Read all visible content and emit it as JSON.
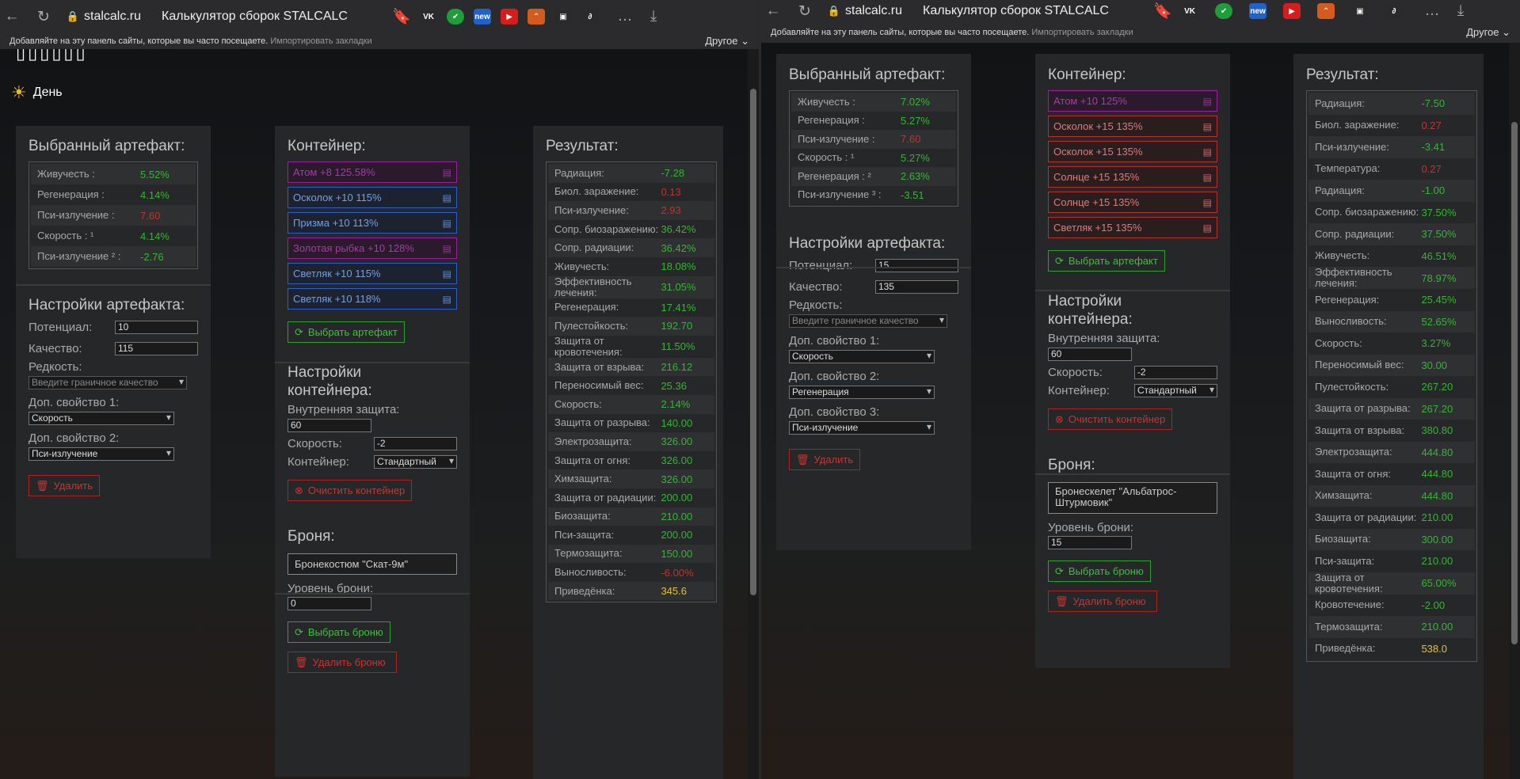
{
  "browser": {
    "back": "←",
    "reload": "↻",
    "lock": "🔒",
    "host": "stalcalc.ru",
    "title": "Калькулятор сборок STALCALC",
    "bookmark": "🔖",
    "download": "⤓",
    "more": "…",
    "exts": [
      {
        "label": "VK",
        "color": "#2a2a2a"
      },
      {
        "label": "✔",
        "color": "#1f9d3b"
      },
      {
        "label": "new",
        "color": "#2062c8"
      },
      {
        "label": "▶",
        "color": "#d41e1e"
      },
      {
        "label": "⌃",
        "color": "#d45a1e"
      },
      {
        "label": "▣",
        "color": "#2a2a2a"
      },
      {
        "label": "∂",
        "color": "#2a2a2a"
      }
    ],
    "bm_text": "Добавляйте на эту панель сайты, которые вы часто посещаете.",
    "bm_import": "Импортировать закладки",
    "bm_other": "Другое ⌄"
  },
  "common": {
    "selected_title": "Выбранный артефакт:",
    "container_title": "Контейнер:",
    "result_title": "Результат:",
    "settings_title": "Настройки артефакта:",
    "potential": "Потенциал:",
    "quality": "Качество:",
    "rarity": "Редкость:",
    "rarity_placeholder": "Введите граничное качество",
    "extra1": "Доп. свойство 1:",
    "extra2": "Доп. свойство 2:",
    "extra3": "Доп. свойство 3:",
    "delete": "Удалить",
    "choose_art": "Выбрать артефакт",
    "cont_settings": "Настройки контейнера:",
    "inner_protect": "Внутренняя защита:",
    "speed": "Скорость:",
    "container": "Контейнер:",
    "container_type": "Стандартный",
    "clear_cont": "Очистить контейнер",
    "armor": "Броня:",
    "armor_level": "Уровень брони:",
    "choose_armor": "Выбрать броню",
    "delete_armor": "Удалить броню"
  },
  "left": {
    "logo": "▯▯▯▯▯▯",
    "day": "День",
    "artifact": [
      {
        "label": "Живучесть :",
        "value": "5.52%",
        "tone": "pos"
      },
      {
        "label": "Регенерация :",
        "value": "4.14%",
        "tone": "pos"
      },
      {
        "label": "Пси-излучение :",
        "value": "7.60",
        "tone": "neg"
      },
      {
        "label": "Скорость : ¹",
        "value": "4.14%",
        "tone": "pos"
      },
      {
        "label": "Пси-излучение ² :",
        "value": "-2.76",
        "tone": "pos"
      }
    ],
    "potential": "10",
    "quality": "115",
    "extra1": "Скорость",
    "extra2": "Пси-излучение",
    "containers": [
      {
        "label": "Атом +8 125.58%",
        "tone": "pink"
      },
      {
        "label": "Осколок +10 115%",
        "tone": "blue"
      },
      {
        "label": "Призма +10 113%",
        "tone": "blue"
      },
      {
        "label": "Золотая рыбка +10 128%",
        "tone": "pink"
      },
      {
        "label": "Светляк +10 115%",
        "tone": "blue"
      },
      {
        "label": "Светляк +10 118%",
        "tone": "blue"
      }
    ],
    "inner": "60",
    "speed": "-2",
    "armor_name": "Бронекостюм \"Скат-9м\"",
    "armor_level": "0",
    "results": [
      {
        "label": "Радиация:",
        "value": "-7.28",
        "tone": "pos"
      },
      {
        "label": "Биол. заражение:",
        "value": "0.13",
        "tone": "neg"
      },
      {
        "label": "Пси-излучение:",
        "value": "2.93",
        "tone": "neg"
      },
      {
        "label": "Сопр. биозаражению:",
        "value": "36.42%",
        "tone": "pos"
      },
      {
        "label": "Сопр. радиации:",
        "value": "36.42%",
        "tone": "pos"
      },
      {
        "label": "Живучесть:",
        "value": "18.08%",
        "tone": "pos"
      },
      {
        "label": "Эффективность лечения:",
        "value": "31.05%",
        "tone": "pos"
      },
      {
        "label": "Регенерация:",
        "value": "17.41%",
        "tone": "pos"
      },
      {
        "label": "Пулестойкость:",
        "value": "192.70",
        "tone": "pos"
      },
      {
        "label": "Защита от кровотечения:",
        "value": "11.50%",
        "tone": "pos"
      },
      {
        "label": "Защита от взрыва:",
        "value": "216.12",
        "tone": "pos"
      },
      {
        "label": "Переносимый вес:",
        "value": "25.36",
        "tone": "pos"
      },
      {
        "label": "Скорость:",
        "value": "2.14%",
        "tone": "pos"
      },
      {
        "label": "Защита от разрыва:",
        "value": "140.00",
        "tone": "pos"
      },
      {
        "label": "Электрозащита:",
        "value": "326.00",
        "tone": "pos"
      },
      {
        "label": "Защита от огня:",
        "value": "326.00",
        "tone": "pos"
      },
      {
        "label": "Химзащита:",
        "value": "326.00",
        "tone": "pos"
      },
      {
        "label": "Защита от радиации:",
        "value": "200.00",
        "tone": "pos"
      },
      {
        "label": "Биозащита:",
        "value": "210.00",
        "tone": "pos"
      },
      {
        "label": "Пси-защита:",
        "value": "200.00",
        "tone": "pos"
      },
      {
        "label": "Термозащита:",
        "value": "150.00",
        "tone": "pos"
      },
      {
        "label": "Выносливость:",
        "value": "-6.00%",
        "tone": "neg"
      },
      {
        "label": "Приведёнка:",
        "value": "345.6",
        "tone": "gold"
      }
    ]
  },
  "right": {
    "artifact": [
      {
        "label": "Живучесть :",
        "value": "7.02%",
        "tone": "pos"
      },
      {
        "label": "Регенерация :",
        "value": "5.27%",
        "tone": "pos"
      },
      {
        "label": "Пси-излучение :",
        "value": "7.60",
        "tone": "neg"
      },
      {
        "label": "Скорость : ¹",
        "value": "5.27%",
        "tone": "pos"
      },
      {
        "label": "Регенерация : ²",
        "value": "2.63%",
        "tone": "pos"
      },
      {
        "label": "Пси-излучение ³ :",
        "value": "-3.51",
        "tone": "pos"
      }
    ],
    "potential": "15",
    "quality": "135",
    "extra1": "Скорость",
    "extra2": "Регенерация",
    "extra3": "Пси-излучение",
    "containers": [
      {
        "label": "Атом +10 125%",
        "tone": "pink"
      },
      {
        "label": "Осколок +15 135%",
        "tone": "red"
      },
      {
        "label": "Осколок +15 135%",
        "tone": "red"
      },
      {
        "label": "Солнце +15 135%",
        "tone": "red"
      },
      {
        "label": "Солнце +15 135%",
        "tone": "red"
      },
      {
        "label": "Светляк +15 135%",
        "tone": "red"
      }
    ],
    "inner": "60",
    "speed": "-2",
    "armor_name": "Бронескелет \"Альбатрос-Штурмовик\"",
    "armor_level": "15",
    "results": [
      {
        "label": "Радиация:",
        "value": "-7.50",
        "tone": "pos"
      },
      {
        "label": "Биол. заражение:",
        "value": "0.27",
        "tone": "neg"
      },
      {
        "label": "Пси-излучение:",
        "value": "-3.41",
        "tone": "pos"
      },
      {
        "label": "Температура:",
        "value": "0.27",
        "tone": "neg"
      },
      {
        "label": "Радиация:",
        "value": "-1.00",
        "tone": "pos"
      },
      {
        "label": "Сопр. биозаражению:",
        "value": "37.50%",
        "tone": "pos"
      },
      {
        "label": "Сопр. радиации:",
        "value": "37.50%",
        "tone": "pos"
      },
      {
        "label": "Живучесть:",
        "value": "46.51%",
        "tone": "pos"
      },
      {
        "label": "Эффективность лечения:",
        "value": "78.97%",
        "tone": "pos"
      },
      {
        "label": "Регенерация:",
        "value": "25.45%",
        "tone": "pos"
      },
      {
        "label": "Выносливость:",
        "value": "52.65%",
        "tone": "pos"
      },
      {
        "label": "Скорость:",
        "value": "3.27%",
        "tone": "pos"
      },
      {
        "label": "Переносимый вес:",
        "value": "30.00",
        "tone": "pos"
      },
      {
        "label": "Пулестойкость:",
        "value": "267.20",
        "tone": "pos"
      },
      {
        "label": "Защита от разрыва:",
        "value": "267.20",
        "tone": "pos"
      },
      {
        "label": "Защита от взрыва:",
        "value": "380.80",
        "tone": "pos"
      },
      {
        "label": "Электрозащита:",
        "value": "444.80",
        "tone": "pos"
      },
      {
        "label": "Защита от огня:",
        "value": "444.80",
        "tone": "pos"
      },
      {
        "label": "Химзащита:",
        "value": "444.80",
        "tone": "pos"
      },
      {
        "label": "Защита от радиации:",
        "value": "210.00",
        "tone": "pos"
      },
      {
        "label": "Биозащита:",
        "value": "300.00",
        "tone": "pos"
      },
      {
        "label": "Пси-защита:",
        "value": "210.00",
        "tone": "pos"
      },
      {
        "label": "Защита от кровотечения:",
        "value": "65.00%",
        "tone": "pos"
      },
      {
        "label": "Кровотечение:",
        "value": "-2.00",
        "tone": "pos"
      },
      {
        "label": "Термозащита:",
        "value": "210.00",
        "tone": "pos"
      },
      {
        "label": "Приведёнка:",
        "value": "538.0",
        "tone": "gold"
      }
    ]
  }
}
